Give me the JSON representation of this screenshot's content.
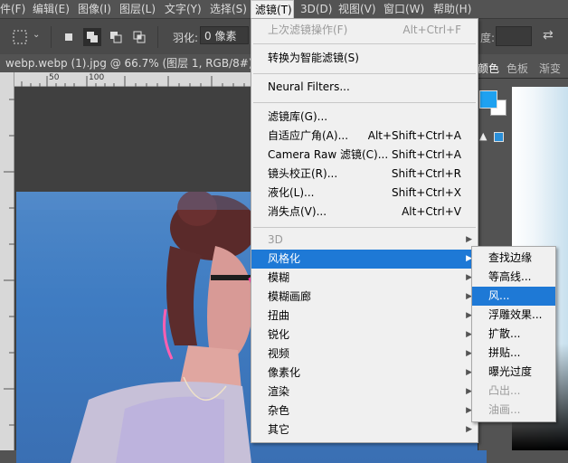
{
  "menubar": {
    "items": [
      "件(F)",
      "编辑(E)",
      "图像(I)",
      "图层(L)",
      "文字(Y)",
      "选择(S)",
      "滤镜(T)",
      "3D(D)",
      "视图(V)",
      "窗口(W)",
      "帮助(H)"
    ],
    "active": "滤镜(T)"
  },
  "options": {
    "feather_label": "羽化:",
    "feather_value": "0 像素",
    "density_label": "度:"
  },
  "document": {
    "tab_title": "webp.webp (1).jpg @ 66.7% (图层 1, RGB/8#) *",
    "close": "×"
  },
  "ruler": {
    "labels": [
      "50",
      "100"
    ]
  },
  "panels": {
    "tabs": [
      "颜色",
      "色板",
      "渐变"
    ],
    "fg_color": "#1ea1f0"
  },
  "filter_menu": {
    "items": [
      {
        "label": "上次滤镜操作(F)",
        "shortcut": "Alt+Ctrl+F",
        "disabled": true
      },
      {
        "label": "转换为智能滤镜(S)",
        "shortcut": ""
      },
      {
        "label": "Neural Filters...",
        "shortcut": ""
      },
      {
        "label": "滤镜库(G)...",
        "shortcut": ""
      },
      {
        "label": "自适应广角(A)...",
        "shortcut": "Alt+Shift+Ctrl+A"
      },
      {
        "label": "Camera Raw 滤镜(C)...",
        "shortcut": "Shift+Ctrl+A"
      },
      {
        "label": "镜头校正(R)...",
        "shortcut": "Shift+Ctrl+R"
      },
      {
        "label": "液化(L)...",
        "shortcut": "Shift+Ctrl+X"
      },
      {
        "label": "消失点(V)...",
        "shortcut": "Alt+Ctrl+V"
      },
      {
        "label": "3D",
        "shortcut": "",
        "disabled": true,
        "submenu": true
      },
      {
        "label": "风格化",
        "shortcut": "",
        "submenu": true,
        "highlight": true
      },
      {
        "label": "模糊",
        "submenu": true
      },
      {
        "label": "模糊画廊",
        "submenu": true
      },
      {
        "label": "扭曲",
        "submenu": true
      },
      {
        "label": "锐化",
        "submenu": true
      },
      {
        "label": "视频",
        "submenu": true
      },
      {
        "label": "像素化",
        "submenu": true
      },
      {
        "label": "渲染",
        "submenu": true
      },
      {
        "label": "杂色",
        "submenu": true
      },
      {
        "label": "其它",
        "submenu": true
      }
    ]
  },
  "stylize_menu": {
    "items": [
      {
        "label": "查找边缘"
      },
      {
        "label": "等高线..."
      },
      {
        "label": "风...",
        "highlight": true
      },
      {
        "label": "浮雕效果..."
      },
      {
        "label": "扩散..."
      },
      {
        "label": "拼贴..."
      },
      {
        "label": "曝光过度"
      },
      {
        "label": "凸出...",
        "disabled": true
      },
      {
        "label": "油画...",
        "disabled": true
      }
    ]
  }
}
